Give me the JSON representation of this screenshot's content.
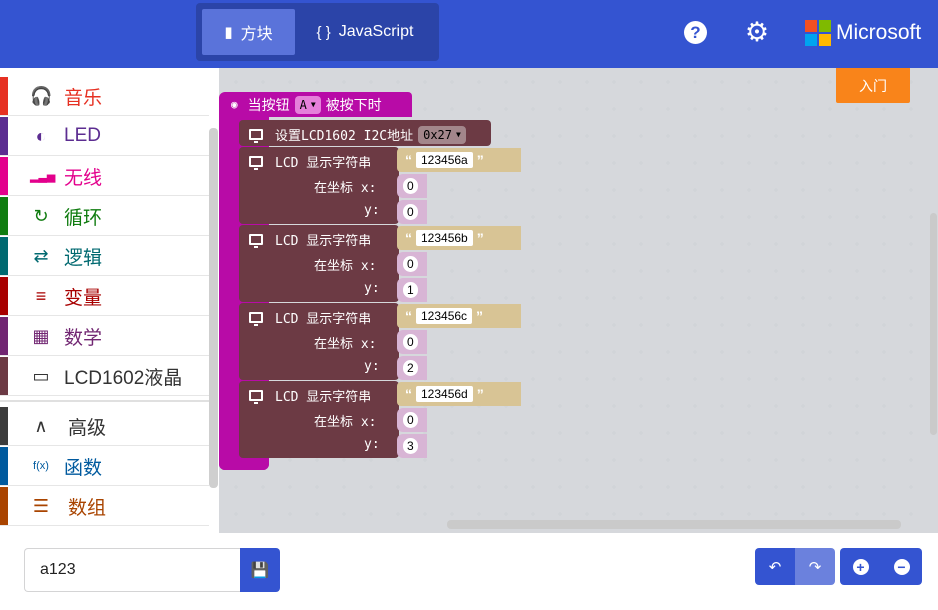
{
  "header": {
    "mode_blocks_label": "方块",
    "mode_js_label": "JavaScript",
    "mode_js_icon": "{ }",
    "brand_text": "Microsoft",
    "brand_colors": [
      "#f25022",
      "#7fba00",
      "#00a4ef",
      "#ffb900"
    ],
    "accent": "#3454d1"
  },
  "toolbox": {
    "categories": [
      {
        "label": "音乐",
        "icon": "headphones-icon",
        "glyph": "🎧",
        "color": "#e63022"
      },
      {
        "label": "LED",
        "icon": "toggle-icon",
        "glyph": "◐",
        "color": "#5c2d91"
      },
      {
        "label": "无线",
        "icon": "signal-icon",
        "glyph": "▂▃▅",
        "color": "#e3008c"
      },
      {
        "label": "循环",
        "icon": "refresh-icon",
        "glyph": "↻",
        "color": "#107c10"
      },
      {
        "label": "逻辑",
        "icon": "shuffle-icon",
        "glyph": "⇄",
        "color": "#006970"
      },
      {
        "label": "变量",
        "icon": "list-icon",
        "glyph": "≡",
        "color": "#a80000"
      },
      {
        "label": "数学",
        "icon": "calculator-icon",
        "glyph": "▦",
        "color": "#712672"
      },
      {
        "label": "LCD1602液晶",
        "icon": "monitor-icon",
        "glyph": "▭",
        "color": "#333333",
        "bar_color": "#6c3a44"
      },
      {
        "label": "高级",
        "icon": "chevron-up-icon",
        "glyph": "∧",
        "color": "#333333",
        "bar_color": "#3c3c3c"
      },
      {
        "label": "函数",
        "icon": "function-icon",
        "glyph": "f(x)",
        "color": "#005a9e"
      },
      {
        "label": "数组",
        "icon": "array-icon",
        "glyph": "☰",
        "color": "#a94400"
      }
    ]
  },
  "workspace": {
    "getting_started_label": "入门",
    "hat_block": {
      "prefix": "当按钮",
      "button": "A",
      "suffix": "被按下时"
    },
    "init_block": {
      "label": "设置LCD1602 I2C地址",
      "address": "0x27"
    },
    "lcd_blocks": [
      {
        "label": "LCD 显示字符串",
        "text": "123456a",
        "pos_label": "在坐标 x:",
        "x": "0",
        "y_label": "y:",
        "y": "0"
      },
      {
        "label": "LCD 显示字符串",
        "text": "123456b",
        "pos_label": "在坐标 x:",
        "x": "0",
        "y_label": "y:",
        "y": "1"
      },
      {
        "label": "LCD 显示字符串",
        "text": "123456c",
        "pos_label": "在坐标 x:",
        "x": "0",
        "y_label": "y:",
        "y": "2"
      },
      {
        "label": "LCD 显示字符串",
        "text": "123456d",
        "pos_label": "在坐标 x:",
        "x": "0",
        "y_label": "y:",
        "y": "3"
      }
    ]
  },
  "footer": {
    "project_name": "a123"
  }
}
